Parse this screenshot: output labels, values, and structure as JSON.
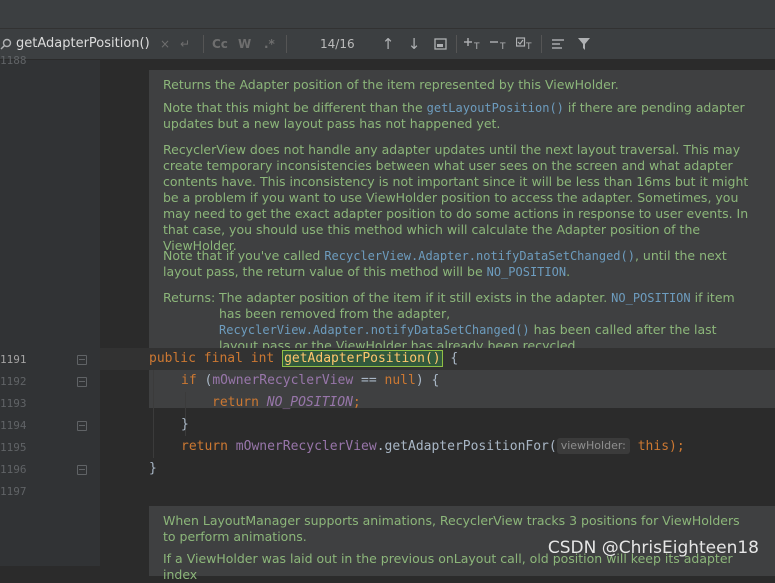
{
  "find_bar": {
    "search_icon": "search-icon",
    "query": "getAdapterPosition()",
    "clear_icon": "×",
    "new_line_icon": "↵",
    "match_case_label": "Cc",
    "words_label": "W",
    "regex_label": ".*",
    "match_count": "14/16",
    "prev_icon": "↑",
    "next_icon": "↓",
    "select_all_icon": "select-all-icon",
    "filter_icon": "filter-icon"
  },
  "gutter": {
    "top_partial": "1188",
    "lines": [
      "1191",
      "1192",
      "1193",
      "1194",
      "1195",
      "1196",
      "1197"
    ]
  },
  "doc_top": {
    "p1": "Returns the Adapter position of the item represented by this ViewHolder.",
    "p2_pre": "Note that this might be different than the ",
    "p2_code": "getLayoutPosition()",
    "p2_post": " if there are pending adapter updates but a new layout pass has not happened yet.",
    "p3": "RecyclerView does not handle any adapter updates until the next layout traversal. This may create temporary inconsistencies between what user sees on the screen and what adapter contents have. This inconsistency is not important since it will be less than 16ms but it might be a problem if you want to use ViewHolder position to access the adapter. Sometimes, you may need to get the exact adapter position to do some actions in response to user events. In that case, you should use this method which will calculate the Adapter position of the ViewHolder.",
    "p4_pre": "Note that if you've called ",
    "p4_code": "RecyclerView.Adapter.notifyDataSetChanged()",
    "p4_mid": ", until the next layout pass, the return value of this method will be ",
    "p4_code2": "NO_POSITION",
    "p4_post": ".",
    "returns_label": "Returns:",
    "returns_pre": "The adapter position of the item if it still exists in the adapter. ",
    "returns_code": "NO_POSITION",
    "returns_mid": " if item has been removed from the adapter, ",
    "returns_code2": "RecyclerView.Adapter.notifyDataSetChanged()",
    "returns_post": " has been called after the last layout pass or the ViewHolder has already been recycled."
  },
  "code": {
    "l1_kw": "public final int ",
    "l1_fn": "getAdapterPosition()",
    "l1_end": " {",
    "l2_kw": "if ",
    "l2_open": "(",
    "l2_field": "mOwnerRecyclerView",
    "l2_op": " == ",
    "l2_null": "null",
    "l2_end": ") {",
    "l3_kw": "return ",
    "l3_const": "NO_POSITION",
    "l3_end": ";",
    "l4": "}",
    "l5_kw": "return ",
    "l5_field": "mOwnerRecyclerView",
    "l5_call": ".getAdapterPositionFor(",
    "l5_hint": "viewHolder:",
    "l5_this": "this",
    "l5_end": ");",
    "l6": "}"
  },
  "doc_bottom": {
    "p1": "When LayoutManager supports animations, RecyclerView tracks 3 positions for ViewHolders to perform animations.",
    "p2": "If a ViewHolder was laid out in the previous onLayout call, old position will keep its adapter index"
  },
  "watermark": "CSDN @ChrisEighteen18"
}
